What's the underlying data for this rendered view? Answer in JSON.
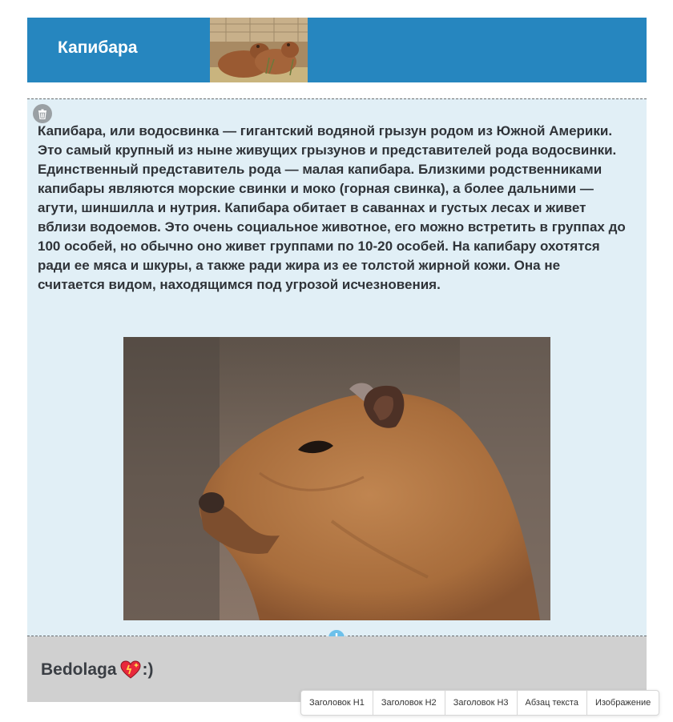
{
  "header": {
    "title": "Капибара",
    "thumbnail_icon": "capybara-photo",
    "background": "#2686bf"
  },
  "content": {
    "delete_icon": "trash-icon",
    "paragraph": "Капибара, или водосвинка — гигантский водяной грызун родом из Южной Америки. Это самый крупный из ныне живущих грызунов и представителей рода водосвинки. Единственный представитель рода — малая капибара. Близкими родственниками капибары являются морские свинки и моко (горная свинка), а более дальними — агути, шиншилла и нутрия. Капибара обитает в саваннах и густых лесах и живет вблизи водоемов. Это очень социальное животное, его можно встретить в группах до 100 особей, но обычно оно живет группами по 10-20 особей. На капибару охотятся ради ее мяса и шкуры, а также ради жира из ее толстой жирной кожи. Она не считается видом, находящимся под угрозой исчезновения.",
    "photo_icon": "capybara-head-photo",
    "add_icon": "plus-icon",
    "background": "#e1eff6"
  },
  "footer": {
    "name": "Bedolaga",
    "emoji_icon": "sparkling-heart-icon",
    "suffix": ":)"
  },
  "toolbar": {
    "buttons": [
      "Заголовок H1",
      "Заголовок H2",
      "Заголовок H3",
      "Абзац текста",
      "Изображение"
    ]
  }
}
